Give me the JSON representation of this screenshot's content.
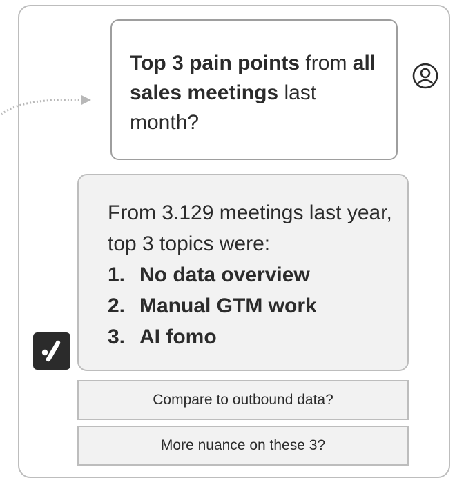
{
  "user_message": {
    "bold_1": "Top 3 pain points",
    "text_1": " from ",
    "bold_2": "all sales meetings",
    "text_2": " last month?"
  },
  "answer": {
    "intro": "From 3.129 meetings last year, top 3 topics were:",
    "items": [
      {
        "number": "1.",
        "label": "No data overview"
      },
      {
        "number": "2.",
        "label": "Manual GTM work"
      },
      {
        "number": "3.",
        "label": "AI fomo"
      }
    ]
  },
  "suggestions": [
    {
      "label": "Compare to outbound data?"
    },
    {
      "label": "More nuance on these 3?"
    }
  ],
  "icons": {
    "user": "user-avatar-icon",
    "app": "app-logo-icon"
  },
  "colors": {
    "panel_border": "#bdbdbd",
    "bubble_fill": "#f2f2f2",
    "icon_dark": "#2b2b2b"
  }
}
